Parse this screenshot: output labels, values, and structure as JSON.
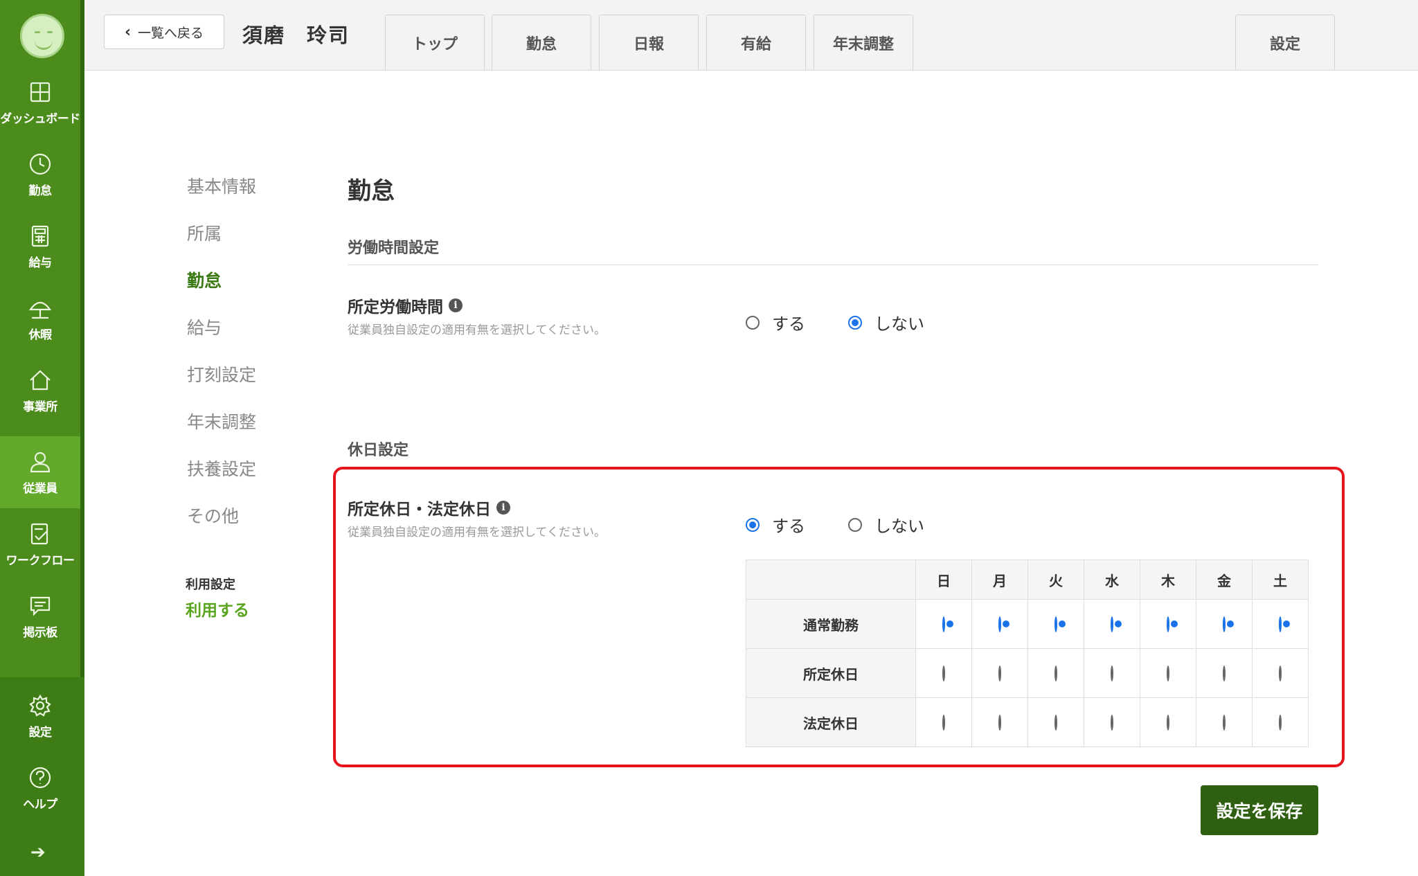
{
  "sidebar": {
    "items": [
      {
        "label": "ダッシュボード",
        "icon": "dashboard-icon"
      },
      {
        "label": "勤怠",
        "icon": "clock-icon"
      },
      {
        "label": "給与",
        "icon": "calculator-icon"
      },
      {
        "label": "休暇",
        "icon": "umbrella-icon"
      },
      {
        "label": "事業所",
        "icon": "home-icon"
      },
      {
        "label": "従業員",
        "icon": "person-icon"
      },
      {
        "label": "ワークフロー",
        "icon": "checklist-icon"
      },
      {
        "label": "掲示板",
        "icon": "message-icon"
      },
      {
        "label": "設定",
        "icon": "gear-icon"
      },
      {
        "label": "ヘルプ",
        "icon": "help-icon"
      }
    ],
    "active": "従業員",
    "collapse_icon": "arrow-right-icon"
  },
  "header": {
    "back_label": "一覧へ戻る",
    "employee_name": "須磨　玲司",
    "tabs": [
      "トップ",
      "勤怠",
      "日報",
      "有給",
      "年末調整"
    ],
    "settings_tab": "設定"
  },
  "submenu": {
    "items": [
      "基本情報",
      "所属",
      "勤怠",
      "給与",
      "打刻設定",
      "年末調整",
      "扶養設定",
      "その他"
    ],
    "active": "勤怠",
    "usage_label": "利用設定",
    "usage_value": "利用する"
  },
  "main": {
    "title": "勤怠",
    "work_section": {
      "heading": "労働時間設定",
      "field_label": "所定労働時間",
      "field_help": "従業員独自設定の適用有無を選択してください。",
      "option_yes": "する",
      "option_no": "しない",
      "selected": "しない"
    },
    "holiday_section": {
      "heading": "休日設定",
      "field_label": "所定休日・法定休日",
      "field_help": "従業員独自設定の適用有無を選択してください。",
      "option_yes": "する",
      "option_no": "しない",
      "selected": "する",
      "days": [
        "日",
        "月",
        "火",
        "水",
        "木",
        "金",
        "土"
      ],
      "rows": [
        {
          "label": "通常勤務",
          "checked": [
            true,
            true,
            true,
            true,
            true,
            true,
            true
          ]
        },
        {
          "label": "所定休日",
          "checked": [
            false,
            false,
            false,
            false,
            false,
            false,
            false
          ]
        },
        {
          "label": "法定休日",
          "checked": [
            false,
            false,
            false,
            false,
            false,
            false,
            false
          ]
        }
      ]
    },
    "save_label": "設定を保存"
  },
  "colors": {
    "sidebar": "#4c8c1c",
    "accent_green": "#3c7a14",
    "highlight": "#e8141c",
    "radio_blue": "#1a73e8",
    "save_button": "#2f5f10"
  }
}
